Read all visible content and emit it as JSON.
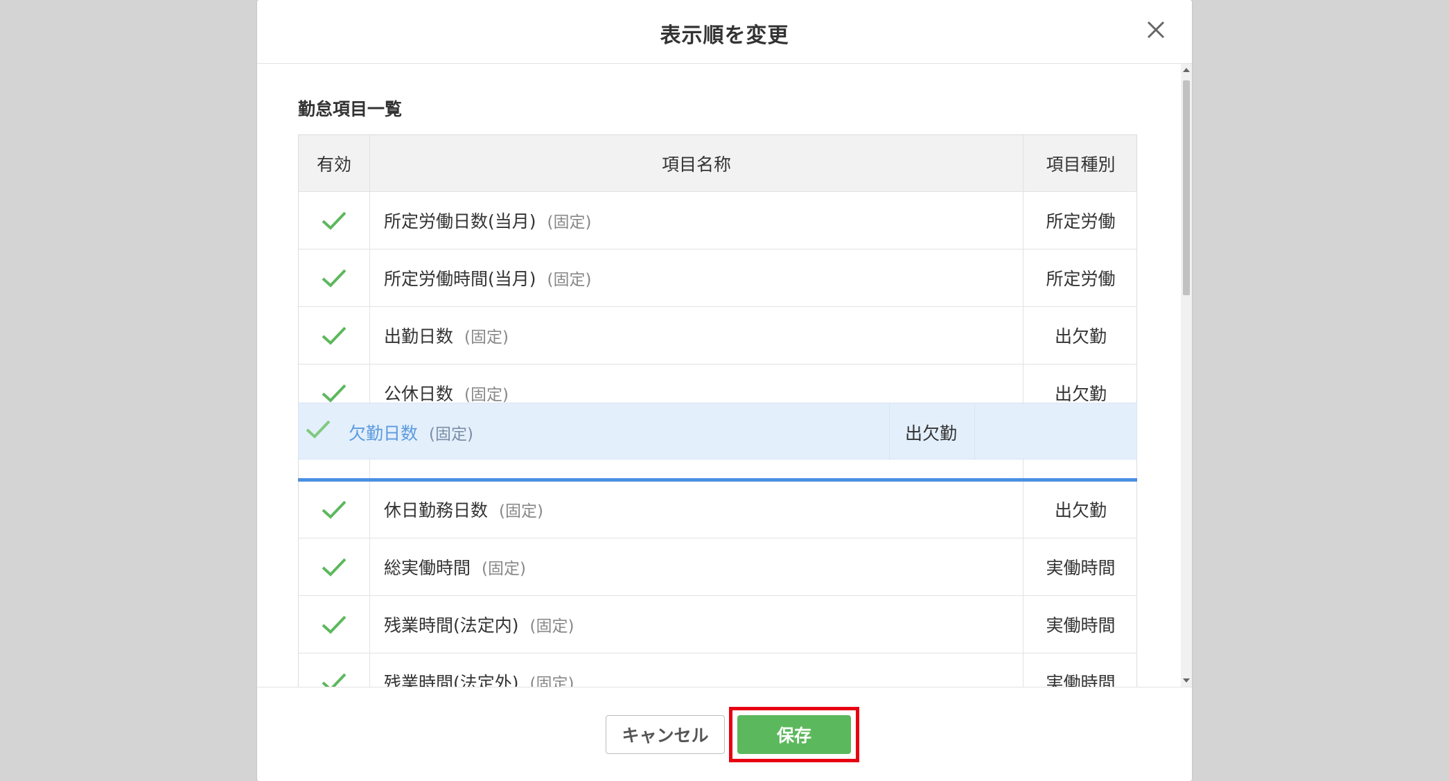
{
  "modal": {
    "title": "表示順を変更",
    "section_title": "勤怠項目一覧"
  },
  "table": {
    "headers": {
      "valid": "有効",
      "name": "項目名称",
      "type": "項目種別"
    },
    "fixed_label": "(固定)",
    "rows": [
      {
        "name": "所定労働日数(当月)",
        "fixed": "(固定)",
        "type": "所定労働"
      },
      {
        "name": "所定労働時間(当月)",
        "fixed": "(固定)",
        "type": "所定労働"
      },
      {
        "name": "出勤日数",
        "fixed": "(固定)",
        "type": "出欠勤"
      },
      {
        "name": "公休日数",
        "fixed": "(固定)",
        "type": "出欠勤"
      },
      {
        "name": "休日勤務日数",
        "fixed": "(固定)",
        "type": "出欠勤"
      },
      {
        "name": "総実働時間",
        "fixed": "(固定)",
        "type": "実働時間"
      },
      {
        "name": "残業時間(法定内)",
        "fixed": "(固定)",
        "type": "実働時間"
      },
      {
        "name": "残業時間(法定外)",
        "fixed": "(固定)",
        "type": "実働時間"
      }
    ]
  },
  "drag_ghost": {
    "name": "欠勤日数",
    "fixed": "(固定)",
    "type": "出欠勤"
  },
  "footer": {
    "cancel_label": "キャンセル",
    "save_label": "保存"
  },
  "colors": {
    "check": "#5cb85c",
    "save_button": "#5cb85c",
    "highlight": "#e60012",
    "drop_indicator": "#4a90e2"
  },
  "icons": {
    "close": "close-icon",
    "check": "check-icon"
  }
}
